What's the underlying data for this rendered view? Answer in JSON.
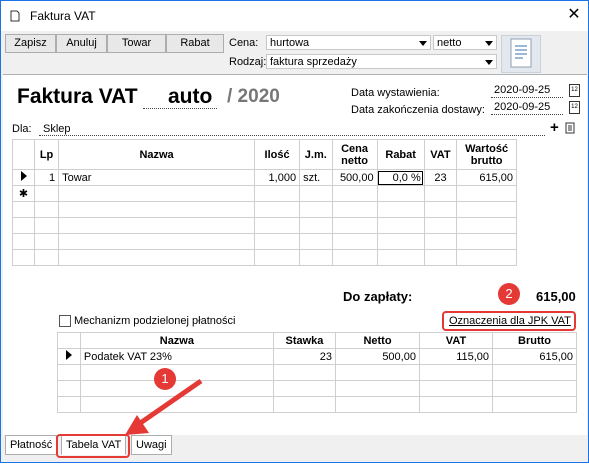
{
  "window": {
    "title": "Faktura VAT",
    "close": "✕"
  },
  "toolbar": {
    "buttons": [
      "Zapisz",
      "Anuluj",
      "Towar",
      "Rabat"
    ],
    "cena_label": "Cena:",
    "cena_value": "hurtowa",
    "cena_type": "netto",
    "rodzaj_label": "Rodzaj:",
    "rodzaj_value": "faktura sprzedaży"
  },
  "header": {
    "title": "Faktura VAT",
    "number": "auto",
    "year": "/ 2020",
    "issue_label": "Data wystawienia:",
    "issue_date": "2020-09-25",
    "delivery_label": "Data zakończenia dostawy:",
    "delivery_date": "2020-09-25",
    "cal_glyph": "12"
  },
  "recipient": {
    "label": "Dla:",
    "value": "Sklep",
    "plus": "+"
  },
  "items_table": {
    "headers": [
      "Lp",
      "Nazwa",
      "Ilość",
      "J.m.",
      "Cena netto",
      "Rabat",
      "VAT",
      "Wartość brutto"
    ],
    "rows": [
      [
        "1",
        "Towar",
        "1,000",
        "szt.",
        "500,00",
        "0,0 %",
        "23",
        "615,00"
      ]
    ],
    "new_row_marker": "✱"
  },
  "summary": {
    "label": "Do zapłaty:",
    "amount": "615,00"
  },
  "split_payment": {
    "label": "Mechanizm podzielonej płatności"
  },
  "jpk_button": "Oznaczenia dla JPK VAT",
  "vat_table": {
    "headers": [
      "Nazwa",
      "Stawka",
      "Netto",
      "VAT",
      "Brutto"
    ],
    "rows": [
      [
        "Podatek VAT 23%",
        "23",
        "500,00",
        "115,00",
        "615,00"
      ]
    ]
  },
  "tabs": [
    "Płatność",
    "Tabela VAT",
    "Uwagi"
  ],
  "annotations": {
    "badge1": "1",
    "badge2": "2",
    "color": "#e53935"
  }
}
